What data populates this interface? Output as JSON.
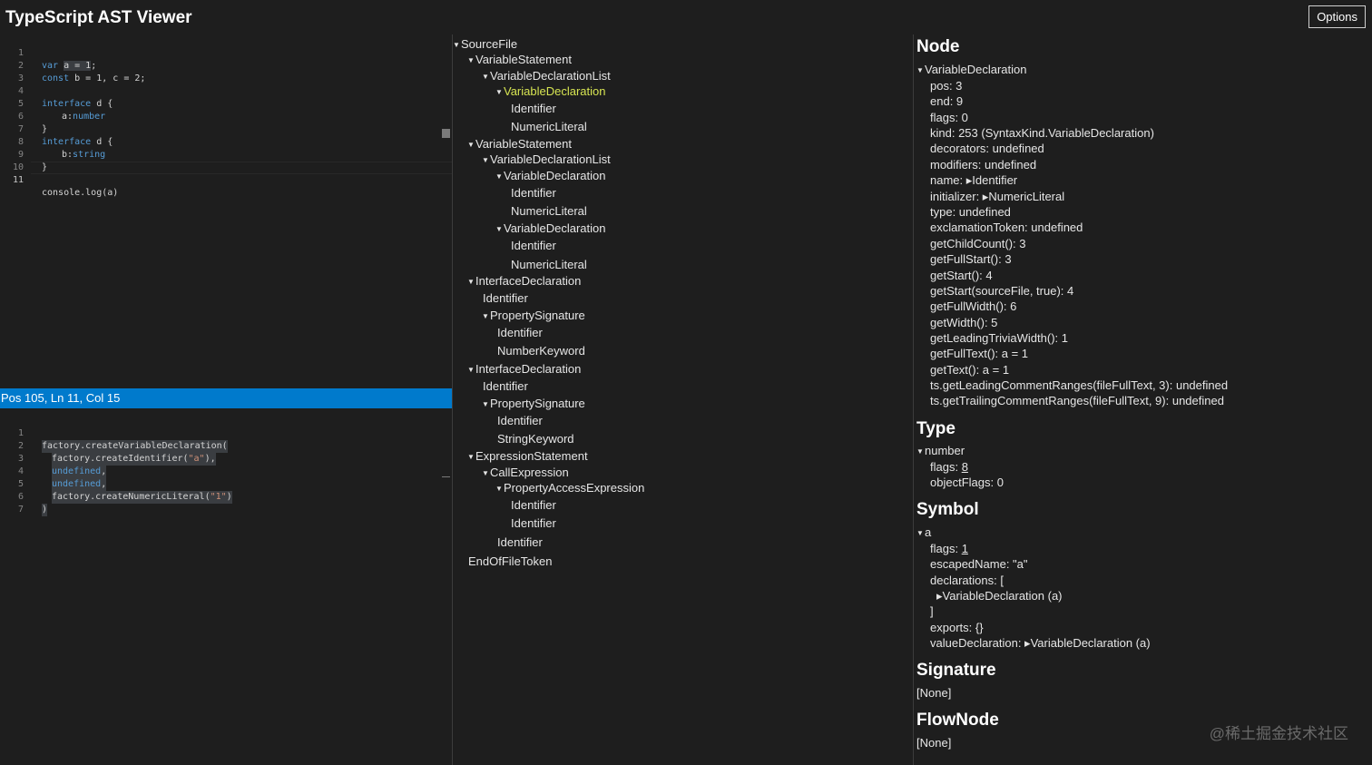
{
  "app": {
    "title": "TypeScript AST Viewer",
    "options_label": "Options"
  },
  "status_bar": {
    "text": "Pos 105, Ln 11, Col 15"
  },
  "source_editor": {
    "line_numbers": [
      "1",
      "2",
      "3",
      "4",
      "5",
      "6",
      "7",
      "8",
      "9",
      "10",
      "11"
    ],
    "l1": {
      "kw": "var",
      "sel": "a = 1",
      "rest": ";"
    },
    "l2": {
      "kw": "const",
      "rest": " b = 1, c = 2;"
    },
    "l4": {
      "kw": "interface",
      "rest": " d {"
    },
    "l5": {
      "name": "a:",
      "type": "number"
    },
    "l6": {
      "text": "}"
    },
    "l7": {
      "kw": "interface",
      "rest": " d {"
    },
    "l8": {
      "name": "b:",
      "type": "string"
    },
    "l9": {
      "text": "}"
    },
    "l11": {
      "text": "console.log(a)"
    }
  },
  "factory_editor": {
    "line_numbers": [
      "1",
      "2",
      "3",
      "4",
      "5",
      "6",
      "7"
    ],
    "l1": "factory.createVariableDeclaration(",
    "l2": {
      "pre": "factory.createIdentifier(",
      "str": "\"a\"",
      "post": "),"
    },
    "l3": {
      "kw": "undefined",
      "post": ","
    },
    "l4": {
      "kw": "undefined",
      "post": ","
    },
    "l5": {
      "pre": "factory.createNumericLiteral(",
      "str": "\"1\"",
      "post": ")"
    },
    "l6": ")"
  },
  "tree": [
    "SourceFile",
    "VariableStatement",
    "VariableDeclarationList",
    "VariableDeclaration",
    "Identifier",
    "NumericLiteral",
    "VariableStatement",
    "VariableDeclarationList",
    "VariableDeclaration",
    "Identifier",
    "NumericLiteral",
    "VariableDeclaration",
    "Identifier",
    "NumericLiteral",
    "InterfaceDeclaration",
    "Identifier",
    "PropertySignature",
    "Identifier",
    "NumberKeyword",
    "InterfaceDeclaration",
    "Identifier",
    "PropertySignature",
    "Identifier",
    "StringKeyword",
    "ExpressionStatement",
    "CallExpression",
    "PropertyAccessExpression",
    "Identifier",
    "Identifier",
    "Identifier",
    "EndOfFileToken"
  ],
  "node": {
    "title": "Node",
    "root": "VariableDeclaration",
    "props": [
      "pos: 3",
      "end: 9",
      "flags: 0",
      "kind: 253 (SyntaxKind.VariableDeclaration)",
      "decorators: undefined",
      "modifiers: undefined",
      "name: ▸Identifier",
      "initializer: ▸NumericLiteral",
      "type: undefined",
      "exclamationToken: undefined",
      "getChildCount(): 3",
      "getFullStart(): 3",
      "getStart(): 4",
      "getStart(sourceFile, true): 4",
      "getFullWidth(): 6",
      "getWidth(): 5",
      "getLeadingTriviaWidth(): 1",
      "getFullText(): a = 1",
      "getText(): a = 1",
      "ts.getLeadingCommentRanges(fileFullText, 3): undefined",
      "ts.getTrailingCommentRanges(fileFullText, 9): undefined"
    ]
  },
  "type": {
    "title": "Type",
    "root": "number",
    "flags_label": "flags: ",
    "flags_value": "8",
    "object_flags": "objectFlags: 0"
  },
  "symbol": {
    "title": "Symbol",
    "root": "a",
    "flags_label": "flags: ",
    "flags_value": "1",
    "escaped_name": "escapedName: \"a\"",
    "declarations_open": "declarations: [",
    "declaration_item": "▸VariableDeclaration (a)",
    "declarations_close": "]",
    "exports": "exports: {}",
    "value_declaration": "valueDeclaration: ▸VariableDeclaration (a)"
  },
  "signature": {
    "title": "Signature",
    "value": "[None]"
  },
  "flow_node": {
    "title": "FlowNode",
    "value": "[None]"
  },
  "watermark": "@稀土掘金技术社区"
}
